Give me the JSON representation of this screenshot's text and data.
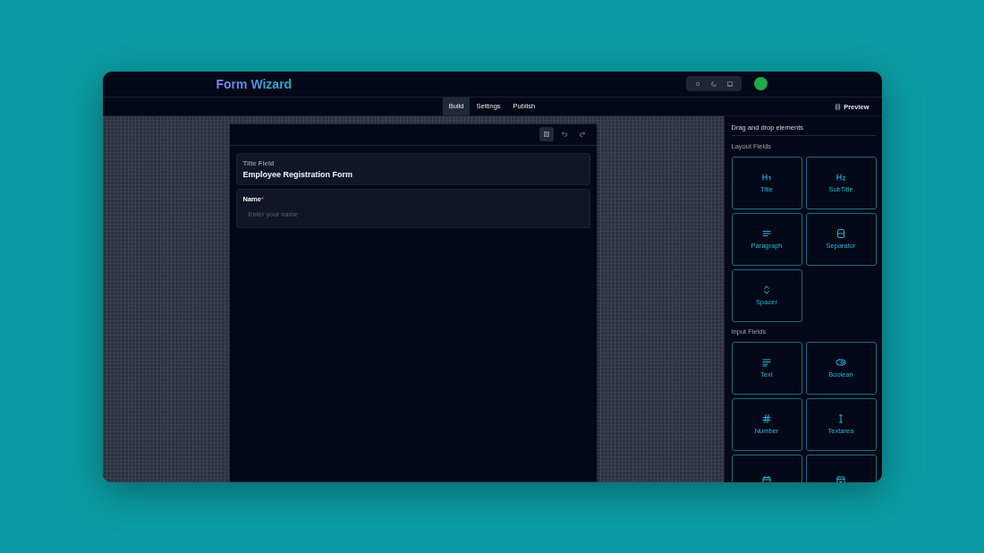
{
  "app": {
    "title": "Form Wizard"
  },
  "tabs": [
    {
      "label": "Build",
      "selected": true
    },
    {
      "label": "Settings",
      "selected": false
    },
    {
      "label": "Publish",
      "selected": false
    }
  ],
  "preview": {
    "label": "Preview"
  },
  "form": {
    "title_card": {
      "label": "Title Field",
      "value": "Employee Registration Form"
    },
    "fields": [
      {
        "label": "Name",
        "required_mark": "*",
        "placeholder": "Enter your name"
      }
    ]
  },
  "sidebar": {
    "heading": "Drag and drop elements",
    "groups": [
      {
        "title": "Layout Fields",
        "items": [
          {
            "label": "Title",
            "kind": "h1"
          },
          {
            "label": "SubTitle",
            "kind": "h2"
          },
          {
            "label": "Paragraph",
            "kind": "paragraph"
          },
          {
            "label": "Separator",
            "kind": "separator"
          },
          {
            "label": "Spacer",
            "kind": "spacer"
          }
        ]
      },
      {
        "title": "Input Fields",
        "items": [
          {
            "label": "Text",
            "kind": "text"
          },
          {
            "label": "Boolean",
            "kind": "boolean"
          },
          {
            "label": "Number",
            "kind": "number"
          },
          {
            "label": "Textarea",
            "kind": "textarea"
          },
          {
            "kind": "date"
          },
          {
            "kind": "select"
          }
        ]
      }
    ]
  }
}
